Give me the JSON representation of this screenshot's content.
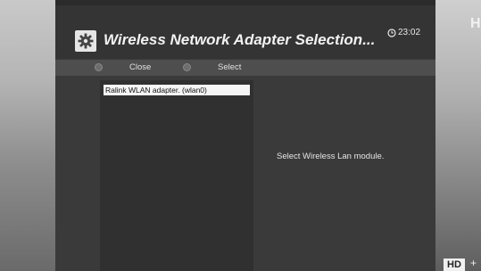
{
  "header": {
    "title": "Wireless Network Adapter Selection...",
    "clock": "23:02"
  },
  "button_bar": {
    "buttons": [
      {
        "label": "Close",
        "icon": "button-dot-icon"
      },
      {
        "label": "Select",
        "icon": "button-dot-icon"
      }
    ]
  },
  "adapter_list": {
    "items": [
      {
        "label": "Ralink WLAN adapter. (wlan0)",
        "selected": true
      }
    ]
  },
  "info": {
    "hint": "Select Wireless Lan module."
  },
  "overlay": {
    "channel_logo": "H",
    "hd_badge": "HD",
    "hd_plus": "+"
  },
  "colors": {
    "panel": "#3a3a3a",
    "button_bar": "#4e4e4e",
    "selected_item": "#f5f5f5",
    "text": "#f2f2f2"
  }
}
